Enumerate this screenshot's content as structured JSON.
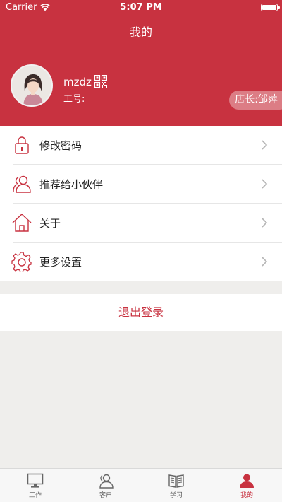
{
  "status_bar": {
    "carrier": "Carrier",
    "time": "5:07 PM"
  },
  "nav": {
    "title": "我的"
  },
  "profile": {
    "username": "mzdz",
    "employee_no_label": "工号:",
    "manager_badge": "店长:邹萍"
  },
  "menu": {
    "items": [
      {
        "label": "修改密码",
        "icon": "lock-icon"
      },
      {
        "label": "推荐给小伙伴",
        "icon": "people-icon"
      },
      {
        "label": "关于",
        "icon": "home-icon"
      },
      {
        "label": "更多设置",
        "icon": "gear-icon"
      }
    ]
  },
  "logout": {
    "label": "退出登录"
  },
  "tabbar": {
    "tabs": [
      {
        "label": "工作",
        "icon": "monitor-icon",
        "active": false
      },
      {
        "label": "客户",
        "icon": "customer-icon",
        "active": false
      },
      {
        "label": "学习",
        "icon": "book-icon",
        "active": false
      },
      {
        "label": "我的",
        "icon": "person-icon",
        "active": true
      }
    ]
  },
  "colors": {
    "brand": "#c83240",
    "badge": "#dc7d85",
    "background": "#efeeec"
  }
}
